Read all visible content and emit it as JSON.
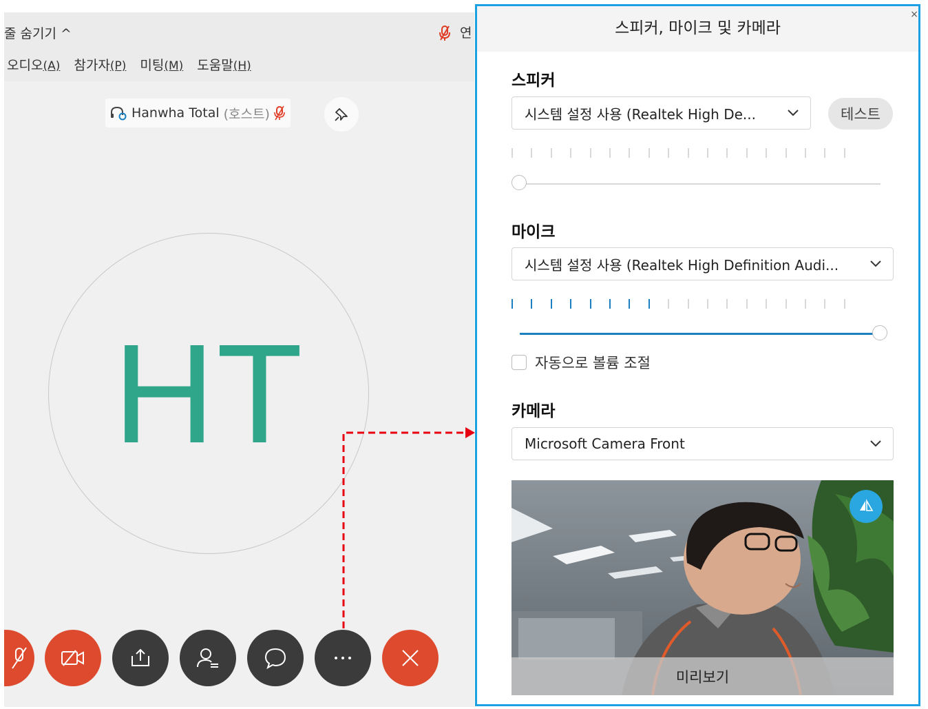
{
  "meeting": {
    "hide_bar_label": "줄 숨기기 ^",
    "connection_label": "연",
    "menu": [
      {
        "label": "오디오",
        "accel": "(A)"
      },
      {
        "label": "참가자",
        "accel": "(P)"
      },
      {
        "label": "미팅",
        "accel": "(M)"
      },
      {
        "label": "도움말",
        "accel": "(H)"
      }
    ],
    "participant": {
      "name": "Hanwha Total",
      "role": "(호스트)"
    },
    "avatar_initials": "HT",
    "controls": [
      {
        "name": "mute",
        "icon": "mic-off-icon",
        "color": "#dd4a2e"
      },
      {
        "name": "video",
        "icon": "video-off-icon",
        "color": "#dd4a2e"
      },
      {
        "name": "share",
        "icon": "share-icon",
        "color": "#3b3b3b"
      },
      {
        "name": "participants",
        "icon": "participants-icon",
        "color": "#3b3b3b"
      },
      {
        "name": "chat",
        "icon": "chat-icon",
        "color": "#3b3b3b"
      },
      {
        "name": "more",
        "icon": "more-icon",
        "color": "#3b3b3b"
      },
      {
        "name": "leave",
        "icon": "close-icon",
        "color": "#dd4a2e"
      }
    ]
  },
  "panel": {
    "title": "스피커, 마이크 및 카메라",
    "close_glyph": "×",
    "speaker": {
      "title": "스피커",
      "selected": "시스템 설정 사용 (Realtek High De...",
      "test_label": "테스트",
      "level_ticks_on": 0,
      "level_ticks_total": 18,
      "volume_fraction": 0.0
    },
    "microphone": {
      "title": "마이크",
      "selected": "시스템 설정 사용 (Realtek High Definition Audi...",
      "level_ticks_on": 8,
      "level_ticks_total": 18,
      "volume_fraction": 1.0,
      "auto_volume_label": "자동으로 볼륨 조절",
      "auto_volume_checked": false
    },
    "camera": {
      "title": "카메라",
      "selected": "Microsoft Camera Front",
      "preview_label": "미리보기"
    }
  },
  "colors": {
    "accent": "#1b7fc1",
    "panel_border": "#1ba1e2",
    "avatar": "#2fa58a",
    "danger": "#dd4a2e",
    "arrow": "#e60012"
  }
}
